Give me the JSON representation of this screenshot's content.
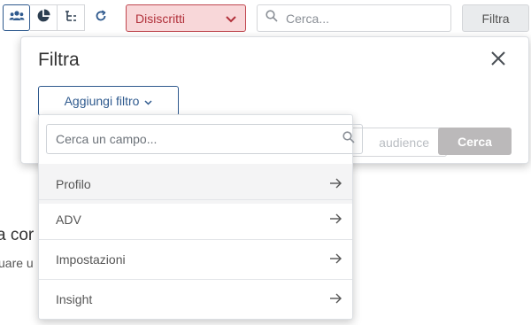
{
  "toolbar": {
    "view_buttons": [
      {
        "icon": "audience-icon",
        "active": true
      },
      {
        "icon": "pie-chart-icon",
        "active": false
      },
      {
        "icon": "tree-icon",
        "active": false
      }
    ],
    "refresh_icon": "refresh-icon",
    "status_select": {
      "value": "Disiscritti",
      "icon": "chevron-down-icon"
    },
    "search": {
      "placeholder": "Cerca...",
      "value": "",
      "icon": "search-icon"
    },
    "filter_button_label": "Filtra"
  },
  "background": {
    "heading_partial": "a cor",
    "sub_partial": "uare u"
  },
  "filter_panel": {
    "title": "Filtra",
    "close_icon": "close-icon",
    "add_filter_label": "Aggiungi filtro",
    "audience_button_label": "audience",
    "search_button_label": "Cerca"
  },
  "field_dropdown": {
    "search_placeholder": "Cerca un campo...",
    "search_value": "",
    "items": [
      {
        "label": "Profilo",
        "hovered": true
      },
      {
        "label": "ADV",
        "hovered": false
      },
      {
        "label": "Impostazioni",
        "hovered": false
      },
      {
        "label": "Insight",
        "hovered": false
      }
    ]
  },
  "colors": {
    "primary": "#2f5a8e",
    "status_bg": "#f8d7d9",
    "status_border": "#c0474f",
    "status_text": "#b1303a",
    "disabled_button": "#bbb9ba"
  }
}
